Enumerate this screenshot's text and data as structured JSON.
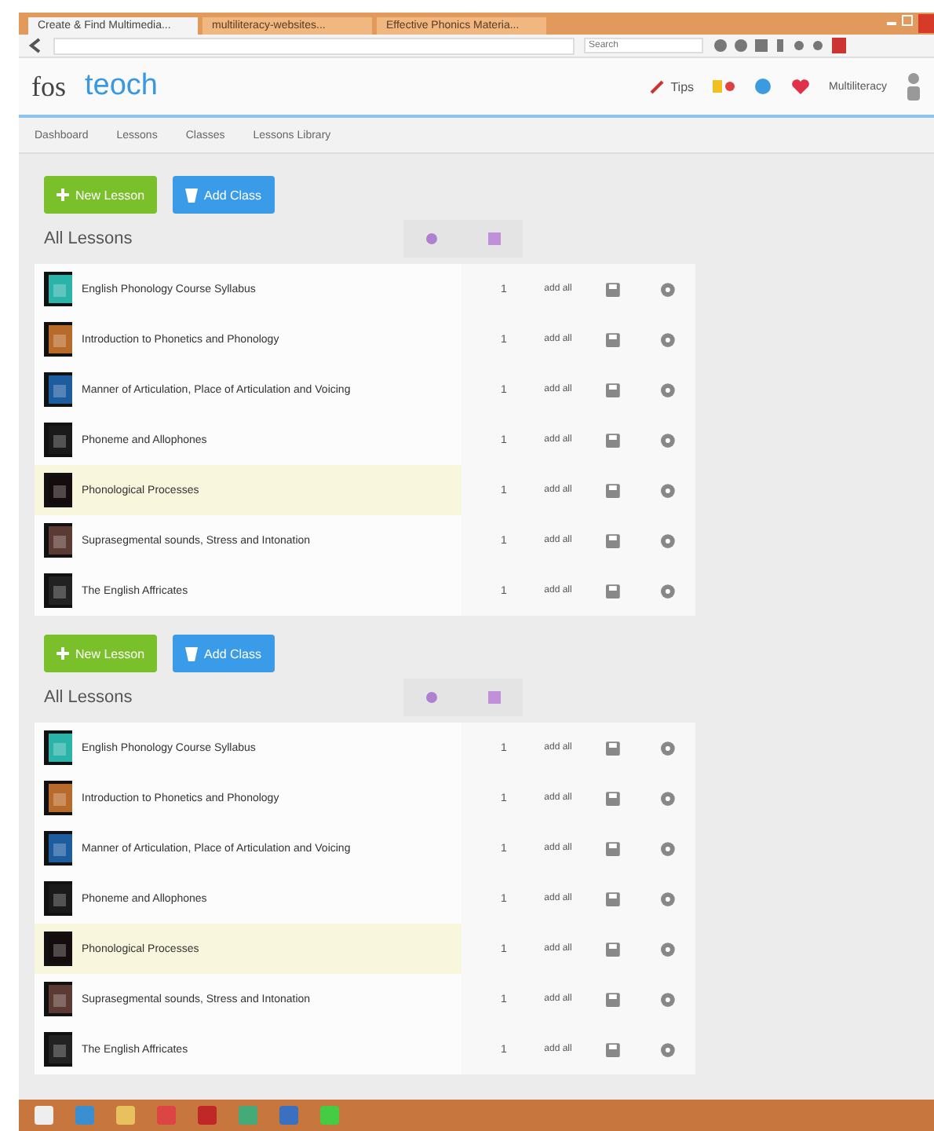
{
  "browser": {
    "tabs": [
      {
        "title": "Create & Find Multimedia...",
        "selected": true
      },
      {
        "title": "multiliteracy-websites...",
        "selected": false
      },
      {
        "title": "Effective Phonics Materia...",
        "selected": false
      }
    ],
    "search_placeholder": "Search"
  },
  "app": {
    "logo_left": "fos",
    "logo_main": "teoch",
    "tips": "Tips",
    "user": "Multiliteracy"
  },
  "nav": [
    {
      "label": "Dashboard"
    },
    {
      "label": "Lessons"
    },
    {
      "label": "Classes"
    },
    {
      "label": "Lessons Library"
    }
  ],
  "sections": [
    {
      "buttons": [
        {
          "kind": "new",
          "label": "New Lesson"
        },
        {
          "kind": "class",
          "label": "Add Class"
        }
      ],
      "heading": "All Lessons",
      "rows": [
        {
          "title": "English Phonology Course Syllabus",
          "count": "1",
          "action": "add all",
          "highlighted": false
        },
        {
          "title": "Introduction to Phonetics and Phonology",
          "count": "1",
          "action": "add all",
          "highlighted": false
        },
        {
          "title": "Manner of Articulation, Place of Articulation and Voicing",
          "count": "1",
          "action": "add all",
          "highlighted": false
        },
        {
          "title": "Phoneme and Allophones",
          "count": "1",
          "action": "add all",
          "highlighted": false
        },
        {
          "title": "Phonological Processes",
          "count": "1",
          "action": "add all",
          "highlighted": true
        },
        {
          "title": "Suprasegmental sounds, Stress and Intonation",
          "count": "1",
          "action": "add all",
          "highlighted": false
        },
        {
          "title": "The English Affricates",
          "count": "1",
          "action": "add all",
          "highlighted": false
        }
      ]
    },
    {
      "buttons": [
        {
          "kind": "new",
          "label": "New Lesson"
        },
        {
          "kind": "class",
          "label": "Add Class"
        }
      ],
      "heading": "All Lessons",
      "rows": [
        {
          "title": "English Phonology Course Syllabus",
          "count": "1",
          "action": "add all",
          "highlighted": false
        },
        {
          "title": "Introduction to Phonetics and Phonology",
          "count": "1",
          "action": "add all",
          "highlighted": false
        },
        {
          "title": "Manner of Articulation, Place of Articulation and Voicing",
          "count": "1",
          "action": "add all",
          "highlighted": false
        },
        {
          "title": "Phoneme and Allophones",
          "count": "1",
          "action": "add all",
          "highlighted": false
        },
        {
          "title": "Phonological Processes",
          "count": "1",
          "action": "add all",
          "highlighted": true
        },
        {
          "title": "Suprasegmental sounds, Stress and Intonation",
          "count": "1",
          "action": "add all",
          "highlighted": false
        },
        {
          "title": "The English Affricates",
          "count": "1",
          "action": "add all",
          "highlighted": false
        }
      ]
    }
  ]
}
